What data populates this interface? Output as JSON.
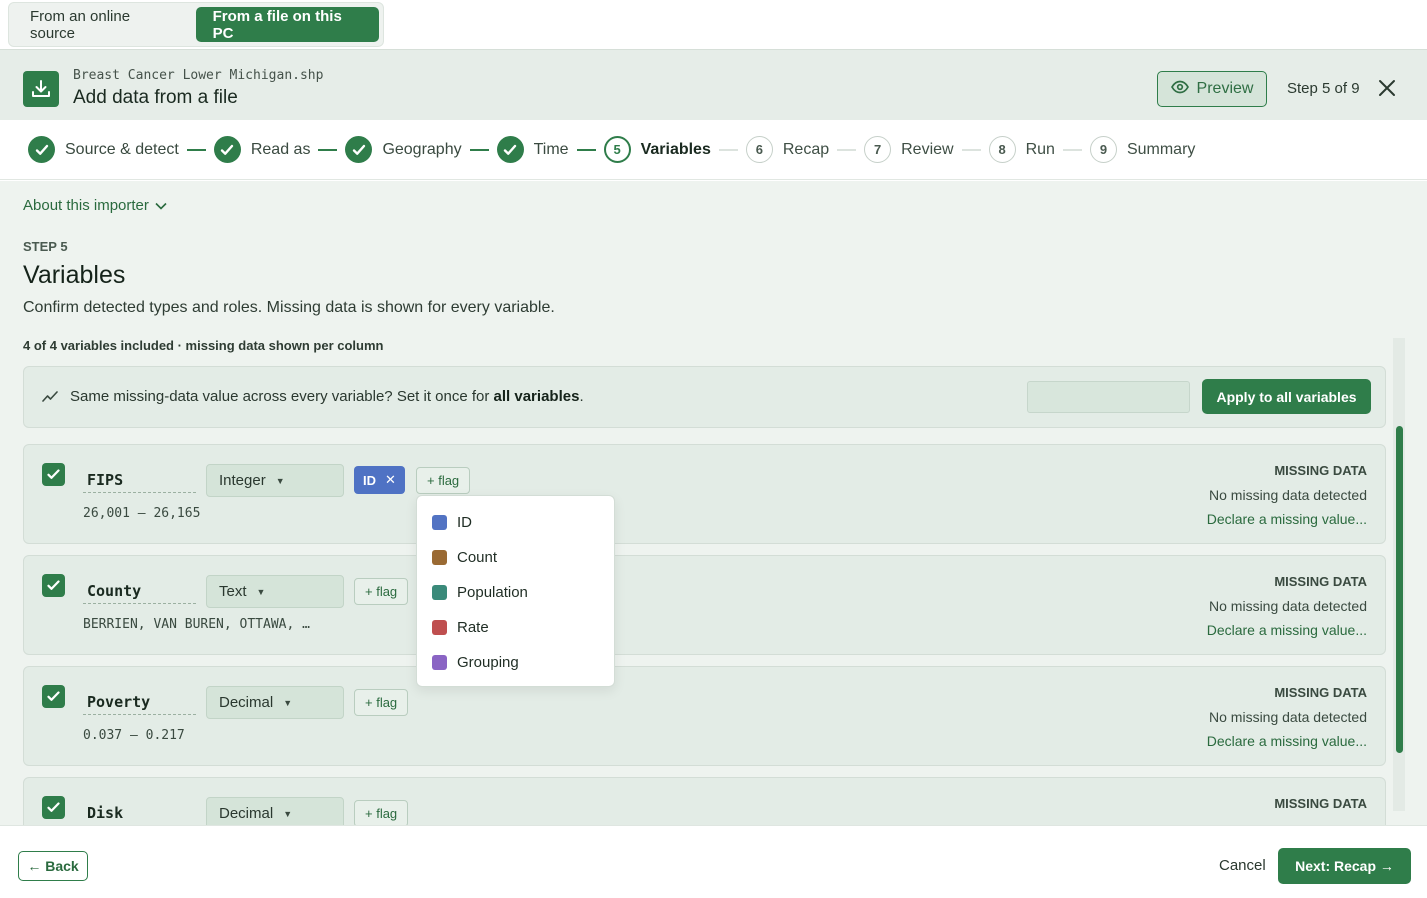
{
  "source_tabs": {
    "online": "From an online source",
    "file": "From a file on this PC"
  },
  "header": {
    "file_name": "Breast Cancer Lower Michigan.shp",
    "title": "Add data from a file",
    "preview_label": "Preview",
    "step_count": "Step 5 of 9"
  },
  "stepper": {
    "steps": [
      {
        "number": "1",
        "label": "Source & detect",
        "state": "done"
      },
      {
        "number": "2",
        "label": "Read as",
        "state": "done"
      },
      {
        "number": "3",
        "label": "Geography",
        "state": "done"
      },
      {
        "number": "4",
        "label": "Time",
        "state": "done"
      },
      {
        "number": "5",
        "label": "Variables",
        "state": "current"
      },
      {
        "number": "6",
        "label": "Recap",
        "state": "todo"
      },
      {
        "number": "7",
        "label": "Review",
        "state": "todo"
      },
      {
        "number": "8",
        "label": "Run",
        "state": "todo"
      },
      {
        "number": "9",
        "label": "Summary",
        "state": "todo"
      }
    ]
  },
  "about_label": "About this importer",
  "step": {
    "kicker": "STEP 5",
    "title": "Variables",
    "description": "Confirm detected types and roles. Missing data is shown for every variable.",
    "count_text": "4 of 4 variables included · missing data shown per column"
  },
  "apply_all": {
    "text_prefix": "Same missing-data value across every variable? Set it once for ",
    "text_bold": "all variables",
    "text_suffix": ".",
    "input_value": "",
    "button_label": "Apply to all variables"
  },
  "variables": [
    {
      "name": "FIPS",
      "range": "26,001 – 26,165",
      "type": "Integer",
      "flag": "ID",
      "add_flag": "+ flag",
      "missing_title": "MISSING DATA",
      "missing_status": "No missing data detected",
      "declare": "Declare a missing value..."
    },
    {
      "name": "County",
      "range": "BERRIEN, VAN BUREN, OTTAWA, …",
      "type": "Text",
      "flag": "",
      "add_flag": "+ flag",
      "missing_title": "MISSING DATA",
      "missing_status": "No missing data detected",
      "declare": "Declare a missing value..."
    },
    {
      "name": "Poverty",
      "range": "0.037 – 0.217",
      "type": "Decimal",
      "flag": "",
      "add_flag": "+ flag",
      "missing_title": "MISSING DATA",
      "missing_status": "No missing data detected",
      "declare": "Declare a missing value..."
    },
    {
      "name": "Disk",
      "range": "",
      "type": "Decimal",
      "flag": "",
      "add_flag": "+ flag",
      "missing_title": "MISSING DATA",
      "missing_status": "",
      "declare": ""
    }
  ],
  "flag_menu": [
    {
      "label": "ID",
      "color": "#5273c3"
    },
    {
      "label": "Count",
      "color": "#9a6a33"
    },
    {
      "label": "Population",
      "color": "#3a8a7a"
    },
    {
      "label": "Rate",
      "color": "#bf4f4f"
    },
    {
      "label": "Grouping",
      "color": "#8a64c4"
    }
  ],
  "footer": {
    "back": "← Back",
    "cancel": "Cancel",
    "next": "Next: Recap →"
  },
  "colors": {
    "accent": "#2f7d4a",
    "id_chip": "#4f72c4"
  }
}
